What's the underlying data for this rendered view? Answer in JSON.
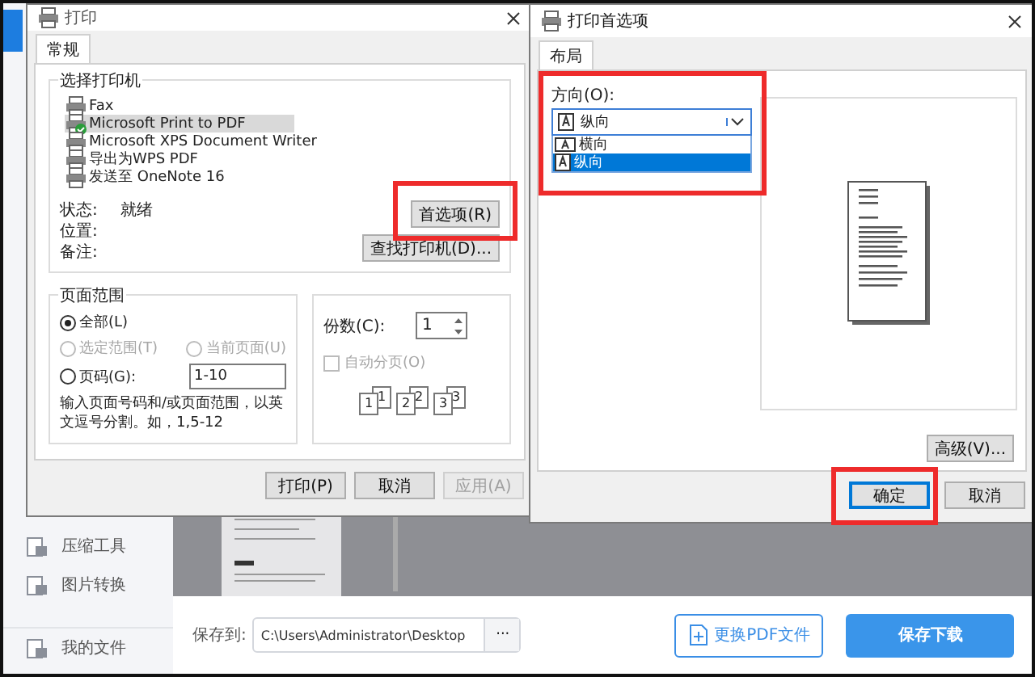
{
  "app": {
    "sidebar_items": [
      {
        "label": "压缩工具"
      },
      {
        "label": "图片转换"
      },
      {
        "label": "我的文件"
      }
    ],
    "save_to": {
      "label": "保存到:",
      "value": "C:\\Users\\Administrator\\Desktop",
      "browse": "···"
    },
    "buttons": [
      {
        "label": "更换PDF文件",
        "kind": "outline"
      },
      {
        "label": "保存下载",
        "kind": "primary"
      }
    ]
  },
  "print_dialog": {
    "title": "打印",
    "tabs": [
      {
        "label": "常规",
        "selected": true
      }
    ],
    "printer_group": {
      "title": "选择打印机",
      "printers": [
        {
          "name": "Fax",
          "selected": false,
          "default": false
        },
        {
          "name": "Microsoft Print to PDF",
          "selected": true,
          "default": true
        },
        {
          "name": "Microsoft XPS Document Writer",
          "selected": false,
          "default": false
        },
        {
          "name": "导出为WPS PDF",
          "selected": false,
          "default": false
        },
        {
          "name": "发送至 OneNote 16",
          "selected": false,
          "default": false
        }
      ],
      "status_label": "状态:",
      "status": "就绪",
      "location_label": "位置:",
      "comment_label": "备注:",
      "buttons": [
        {
          "label": "首选项(R)",
          "highlighted": true
        },
        {
          "label": "查找打印机(D)...",
          "highlighted": false
        }
      ]
    },
    "range_group": {
      "title": "页面范围",
      "options": [
        {
          "label": "全部(L)",
          "selected": true,
          "disabled": false
        },
        {
          "label": "选定范围(T)",
          "selected": false,
          "disabled": true
        },
        {
          "label": "当前页面(U)",
          "selected": false,
          "disabled": true
        },
        {
          "label": "页码(G):",
          "selected": false,
          "disabled": false,
          "value": "1-10"
        }
      ],
      "hint": "输入页面号码和/或页面范围，以英文逗号分割。如，1,5-12"
    },
    "copies_group": {
      "label": "份数(C):",
      "value": "1",
      "collate": {
        "label": "自动分页(O)",
        "checked": false,
        "disabled": true
      },
      "collate_pages": [
        {
          "back": "1",
          "front": "1"
        },
        {
          "back": "2",
          "front": "2"
        },
        {
          "back": "3",
          "front": "3"
        }
      ]
    },
    "buttons": [
      {
        "label": "打印(P)",
        "disabled": false
      },
      {
        "label": "取消",
        "disabled": false
      },
      {
        "label": "应用(A)",
        "disabled": true
      }
    ]
  },
  "preferences_dialog": {
    "title": "打印首选项",
    "tabs": [
      {
        "label": "布局",
        "selected": true
      }
    ],
    "orientation": {
      "label": "方向(O):",
      "value": "纵向",
      "highlighted": true,
      "expanded": true,
      "options": [
        {
          "label": "横向",
          "selected": false
        },
        {
          "label": "纵向",
          "selected": true
        }
      ]
    },
    "advanced_button": "高级(V)...",
    "buttons": [
      {
        "label": "确定",
        "default": true,
        "highlighted": true
      },
      {
        "label": "取消",
        "default": false,
        "highlighted": false
      }
    ]
  }
}
